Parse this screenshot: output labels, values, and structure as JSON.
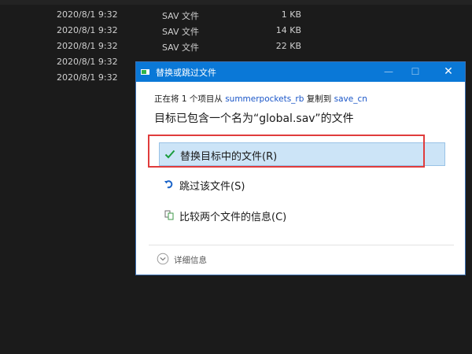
{
  "files": [
    {
      "date": "2020/8/1 9:32",
      "type": "SAV 文件",
      "size": "1 KB"
    },
    {
      "date": "2020/8/1 9:32",
      "type": "SAV 文件",
      "size": "14 KB"
    },
    {
      "date": "2020/8/1 9:32",
      "type": "SAV 文件",
      "size": "22 KB"
    },
    {
      "date": "2020/8/1 9:32",
      "type": "",
      "size": ""
    },
    {
      "date": "2020/8/1 9:32",
      "type": "",
      "size": ""
    }
  ],
  "dialog": {
    "title": "替换或跳过文件",
    "info_prefix": "正在将 1 个项目从 ",
    "source": "summerpockets_rb",
    "info_middle": " 复制到 ",
    "destination": "save_cn",
    "headline": "目标已包含一个名为“global.sav”的文件",
    "options": {
      "replace": "替换目标中的文件(R)",
      "skip": "跳过该文件(S)",
      "compare": "比较两个文件的信息(C)"
    },
    "details": "详细信息"
  },
  "colors": {
    "titlebar": "#0a78d7",
    "selected_option": "#cce4f7",
    "highlight_outline": "#e03c3c",
    "link": "#1a56c8"
  }
}
